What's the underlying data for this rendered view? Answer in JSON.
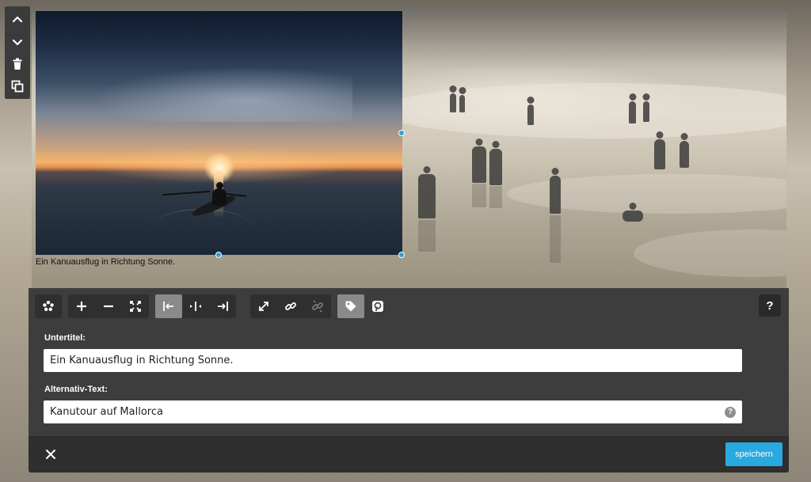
{
  "side_toolbar": {
    "items": [
      {
        "icon": "chevron-up-icon"
      },
      {
        "icon": "chevron-down-icon"
      },
      {
        "icon": "trash-icon"
      },
      {
        "icon": "duplicate-icon"
      }
    ]
  },
  "image": {
    "caption": "Ein Kanuausflug in Richtung Sonne."
  },
  "toolbar": {
    "groups": [
      {
        "buttons": [
          {
            "icon": "filter-effects-icon"
          }
        ]
      },
      {
        "buttons": [
          {
            "icon": "zoom-in-icon"
          },
          {
            "icon": "zoom-out-icon"
          },
          {
            "icon": "fit-icon"
          }
        ]
      },
      {
        "buttons": [
          {
            "icon": "align-left-icon",
            "active": true
          },
          {
            "icon": "align-center-icon"
          },
          {
            "icon": "align-right-icon"
          }
        ]
      },
      {
        "buttons": [
          {
            "icon": "expand-icon"
          },
          {
            "icon": "link-icon"
          },
          {
            "icon": "unlink-icon",
            "disabled": true
          }
        ]
      },
      {
        "buttons": [
          {
            "icon": "tag-icon",
            "active": true
          },
          {
            "icon": "pinterest-icon"
          }
        ]
      }
    ],
    "help_label": "?"
  },
  "form": {
    "subtitle_label": "Untertitel:",
    "subtitle_value": "Ein Kanuausflug in Richtung Sonne.",
    "alt_label": "Alternativ-Text:",
    "alt_value": "Kanutour auf Mallorca",
    "alt_help": "?"
  },
  "footer": {
    "close_icon": "close-icon",
    "save_label": "speichern"
  },
  "colors": {
    "accent": "#28a9e0",
    "panel": "#3d3d3d",
    "footer": "#2e2e2e",
    "active_button": "#8a8a8a"
  }
}
